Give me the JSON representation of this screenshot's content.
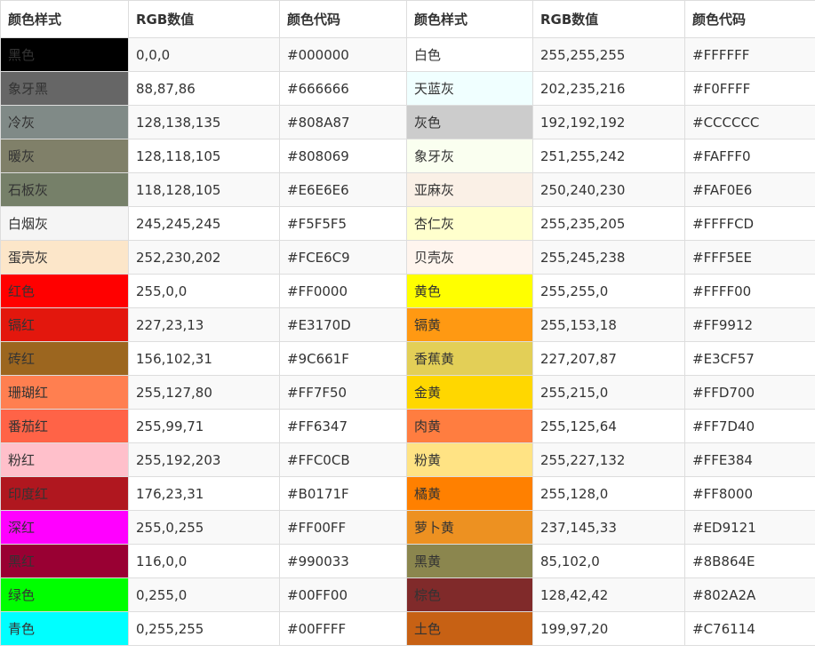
{
  "headers": [
    "颜色样式",
    "RGB数值",
    "颜色代码",
    "颜色样式",
    "RGB数值",
    "颜色代码"
  ],
  "rows": [
    {
      "left": {
        "name": "黑色",
        "rgb": "0,0,0",
        "hex": "#000000",
        "swatch": "#000000"
      },
      "right": {
        "name": "白色",
        "rgb": "255,255,255",
        "hex": "#FFFFFF",
        "swatch": "#FFFFFF"
      }
    },
    {
      "left": {
        "name": "象牙黑",
        "rgb": "88,87,86",
        "hex": "#666666",
        "swatch": "#666666"
      },
      "right": {
        "name": "天蓝灰",
        "rgb": "202,235,216",
        "hex": "#F0FFFF",
        "swatch": "#F0FFFF"
      }
    },
    {
      "left": {
        "name": "冷灰",
        "rgb": "128,138,135",
        "hex": "#808A87",
        "swatch": "#808A87"
      },
      "right": {
        "name": "灰色",
        "rgb": "192,192,192",
        "hex": "#CCCCCC",
        "swatch": "#CCCCCC"
      }
    },
    {
      "left": {
        "name": "暖灰",
        "rgb": "128,118,105",
        "hex": "#808069",
        "swatch": "#808069"
      },
      "right": {
        "name": "象牙灰",
        "rgb": "251,255,242",
        "hex": "#FAFFF0",
        "swatch": "#FAFFF0"
      }
    },
    {
      "left": {
        "name": "石板灰",
        "rgb": "118,128,105",
        "hex": "#E6E6E6",
        "swatch": "#768069"
      },
      "right": {
        "name": "亚麻灰",
        "rgb": "250,240,230",
        "hex": "#FAF0E6",
        "swatch": "#FAF0E6"
      }
    },
    {
      "left": {
        "name": "白烟灰",
        "rgb": "245,245,245",
        "hex": "#F5F5F5",
        "swatch": "#F5F5F5"
      },
      "right": {
        "name": "杏仁灰",
        "rgb": "255,235,205",
        "hex": "#FFFFCD",
        "swatch": "#FFFFCD"
      }
    },
    {
      "left": {
        "name": "蛋壳灰",
        "rgb": "252,230,202",
        "hex": "#FCE6C9",
        "swatch": "#FCE6C9"
      },
      "right": {
        "name": "贝壳灰",
        "rgb": "255,245,238",
        "hex": "#FFF5EE",
        "swatch": "#FFF5EE"
      }
    },
    {
      "left": {
        "name": "红色",
        "rgb": "255,0,0",
        "hex": "#FF0000",
        "swatch": "#FF0000"
      },
      "right": {
        "name": "黄色",
        "rgb": "255,255,0",
        "hex": "#FFFF00",
        "swatch": "#FFFF00"
      }
    },
    {
      "left": {
        "name": "镉红",
        "rgb": "227,23,13",
        "hex": "#E3170D",
        "swatch": "#E3170D"
      },
      "right": {
        "name": "镉黄",
        "rgb": "255,153,18",
        "hex": "#FF9912",
        "swatch": "#FF9912"
      }
    },
    {
      "left": {
        "name": "砖红",
        "rgb": "156,102,31",
        "hex": "#9C661F",
        "swatch": "#9C661F"
      },
      "right": {
        "name": "香蕉黄",
        "rgb": "227,207,87",
        "hex": "#E3CF57",
        "swatch": "#E3CF57"
      }
    },
    {
      "left": {
        "name": "珊瑚红",
        "rgb": "255,127,80",
        "hex": "#FF7F50",
        "swatch": "#FF7F50"
      },
      "right": {
        "name": "金黄",
        "rgb": "255,215,0",
        "hex": "#FFD700",
        "swatch": "#FFD700"
      }
    },
    {
      "left": {
        "name": "番茄红",
        "rgb": "255,99,71",
        "hex": "#FF6347",
        "swatch": "#FF6347"
      },
      "right": {
        "name": "肉黄",
        "rgb": "255,125,64",
        "hex": "#FF7D40",
        "swatch": "#FF7D40"
      }
    },
    {
      "left": {
        "name": "粉红",
        "rgb": "255,192,203",
        "hex": "#FFC0CB",
        "swatch": "#FFC0CB"
      },
      "right": {
        "name": "粉黄",
        "rgb": "255,227,132",
        "hex": "#FFE384",
        "swatch": "#FFE384"
      }
    },
    {
      "left": {
        "name": "印度红",
        "rgb": "176,23,31",
        "hex": "#B0171F",
        "swatch": "#B0171F"
      },
      "right": {
        "name": "橘黄",
        "rgb": "255,128,0",
        "hex": "#FF8000",
        "swatch": "#FF8000"
      }
    },
    {
      "left": {
        "name": "深红",
        "rgb": "255,0,255",
        "hex": "#FF00FF",
        "swatch": "#FF00FF"
      },
      "right": {
        "name": "萝卜黄",
        "rgb": "237,145,33",
        "hex": "#ED9121",
        "swatch": "#ED9121"
      }
    },
    {
      "left": {
        "name": "黑红",
        "rgb": "116,0,0",
        "hex": "#990033",
        "swatch": "#990033"
      },
      "right": {
        "name": "黑黄",
        "rgb": "85,102,0",
        "hex": "#8B864E",
        "swatch": "#8B864E"
      }
    },
    {
      "left": {
        "name": "绿色",
        "rgb": "0,255,0",
        "hex": "#00FF00",
        "swatch": "#00FF00"
      },
      "right": {
        "name": "棕色",
        "rgb": "128,42,42",
        "hex": "#802A2A",
        "swatch": "#802A2A"
      }
    },
    {
      "left": {
        "name": "青色",
        "rgb": "0,255,255",
        "hex": "#00FFFF",
        "swatch": "#00FFFF"
      },
      "right": {
        "name": "土色",
        "rgb": "199,97,20",
        "hex": "#C76114",
        "swatch": "#C76114"
      }
    }
  ],
  "colors": {
    "border": "#dddddd",
    "text": "#333333",
    "row_alt": "#f9f9f9"
  }
}
